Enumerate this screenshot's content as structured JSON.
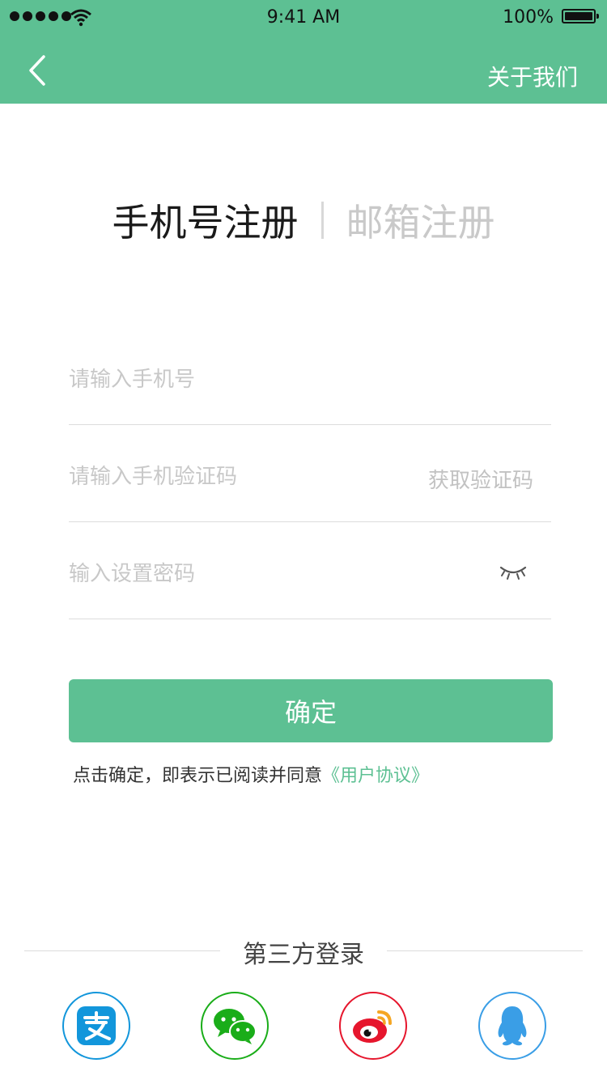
{
  "status_bar": {
    "time": "9:41 AM",
    "battery": "100%"
  },
  "nav": {
    "back_icon": "chevron-left-icon",
    "about": "关于我们"
  },
  "tabs": [
    {
      "label": "手机号注册",
      "active": true
    },
    {
      "label": "邮箱注册",
      "active": false
    }
  ],
  "form": {
    "phone_placeholder": "请输入手机号",
    "code_placeholder": "请输入手机验证码",
    "get_code": "获取验证码",
    "password_placeholder": "输入设置密码",
    "eye_icon": "eye-closed-icon"
  },
  "confirm": "确定",
  "agreement": {
    "text": "点击确定，即表示已阅读并同意",
    "link": "《用户协议》"
  },
  "third_party": {
    "label": "第三方登录",
    "providers": [
      {
        "name": "alipay",
        "icon": "alipay-icon",
        "color": "#1296db"
      },
      {
        "name": "wechat",
        "icon": "wechat-icon",
        "color": "#1aad19"
      },
      {
        "name": "weibo",
        "icon": "weibo-icon",
        "color": "#e6162d"
      },
      {
        "name": "qq",
        "icon": "qq-icon",
        "color": "#3a9ee6"
      }
    ]
  },
  "colors": {
    "accent": "#5dc093",
    "placeholder": "#c8c8c8",
    "divider": "#dcdcdc"
  }
}
